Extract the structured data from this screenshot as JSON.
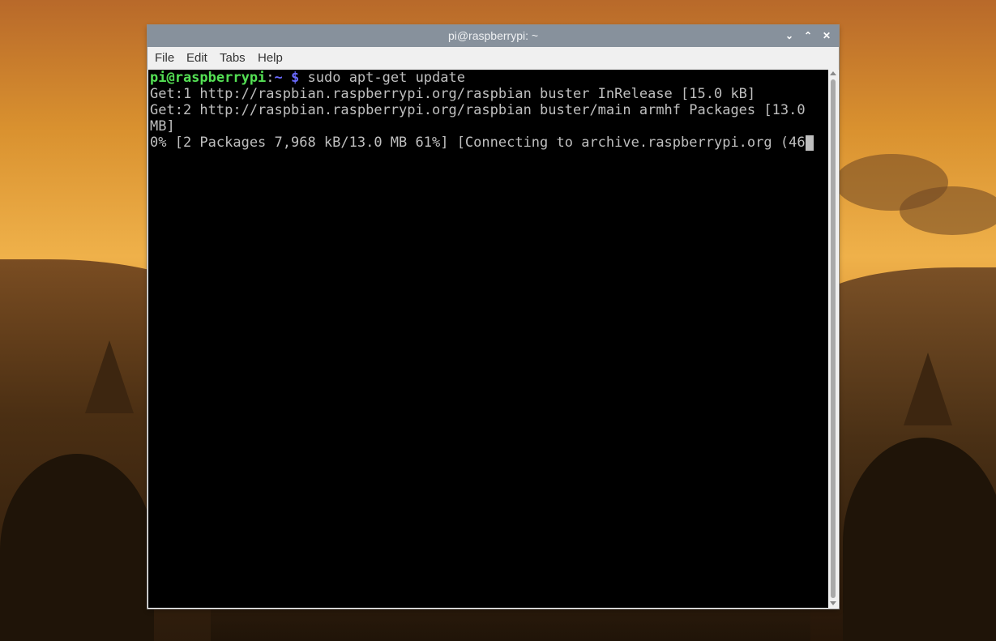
{
  "window": {
    "title": "pi@raspberrypi: ~",
    "controls": {
      "minimize_glyph": "⌄",
      "maximize_glyph": "⌃",
      "close_glyph": "✕"
    }
  },
  "menubar": {
    "items": [
      {
        "label": "File"
      },
      {
        "label": "Edit"
      },
      {
        "label": "Tabs"
      },
      {
        "label": "Help"
      }
    ]
  },
  "terminal": {
    "prompt": {
      "user_host": "pi@raspberrypi",
      "separator": ":",
      "path": "~",
      "symbol": " $",
      "command": " sudo apt-get update"
    },
    "output_lines": [
      "Get:1 http://raspbian.raspberrypi.org/raspbian buster InRelease [15.0 kB]",
      "Get:2 http://raspbian.raspberrypi.org/raspbian buster/main armhf Packages [13.0",
      "MB]",
      "0% [2 Packages 7,968 kB/13.0 MB 61%] [Connecting to archive.raspberrypi.org (46"
    ]
  },
  "colors": {
    "prompt_user": "#54e054",
    "prompt_path": "#6a6aff",
    "terminal_text": "#bfbfbf",
    "terminal_bg": "#000000",
    "titlebar_bg": "#87919c"
  }
}
